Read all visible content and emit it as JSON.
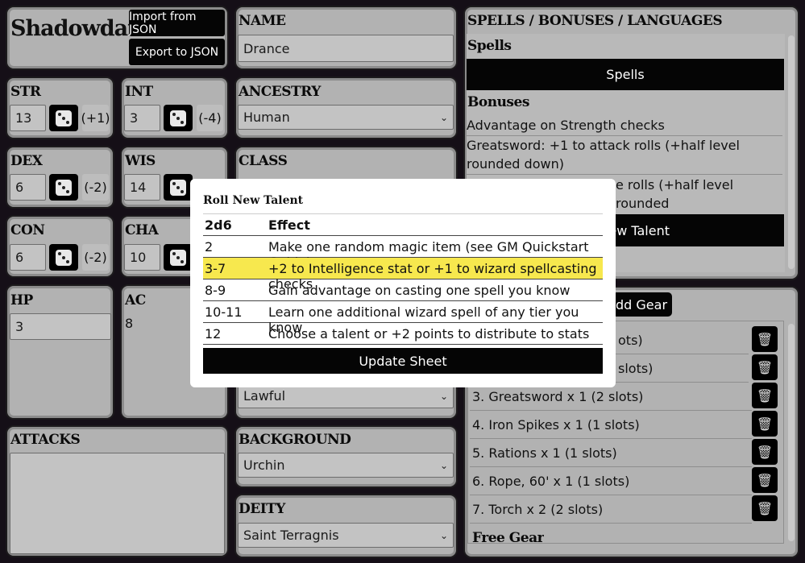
{
  "app": {
    "title": "Shadowdark"
  },
  "toolbar": {
    "import_label": "Import from JSON",
    "export_label": "Export to JSON"
  },
  "stats": [
    {
      "label": "STR",
      "value": "13",
      "mod": "(+1)"
    },
    {
      "label": "INT",
      "value": "3",
      "mod": "(-4)"
    },
    {
      "label": "DEX",
      "value": "6",
      "mod": "(-2)"
    },
    {
      "label": "WIS",
      "value": "14",
      "mod": ""
    },
    {
      "label": "CON",
      "value": "6",
      "mod": "(-2)"
    },
    {
      "label": "CHA",
      "value": "10",
      "mod": ""
    }
  ],
  "hp": {
    "label": "HP",
    "value": "3"
  },
  "ac": {
    "label": "AC",
    "value": "8"
  },
  "attacks": {
    "label": "ATTACKS"
  },
  "name": {
    "label": "NAME",
    "value": "Drance"
  },
  "ancestry": {
    "label": "ANCESTRY",
    "value": "Human"
  },
  "class": {
    "label": "CLASS"
  },
  "alignment": {
    "value": "Lawful"
  },
  "background": {
    "label": "BACKGROUND",
    "value": "Urchin"
  },
  "deity": {
    "label": "DEITY",
    "value": "Saint Terragnis"
  },
  "spells_panel": {
    "label": "SPELLS / BONUSES / LANGUAGES",
    "spells_heading": "Spells",
    "spells_button": "Spells",
    "bonuses_heading": "Bonuses",
    "bonuses": [
      "Advantage on Strength checks",
      "Greatsword: +1 to attack rolls (+half level rounded down)",
      "e rolls (+half level rounded"
    ],
    "new_talent_button": "ew Talent"
  },
  "gear": {
    "add_button": "dd Gear",
    "items": [
      "ots)",
      "slots)",
      "3. Greatsword x 1 (2 slots)",
      "4. Iron Spikes x 1 (1 slots)",
      "5. Rations x 1 (1 slots)",
      "6. Rope, 60' x 1 (1 slots)",
      "7. Torch x 2 (2 slots)"
    ],
    "free_gear_heading": "Free Gear"
  },
  "modal": {
    "title": "Roll New Talent",
    "col_roll": "2d6",
    "col_effect": "Effect",
    "rows": [
      {
        "roll": "2",
        "effect": "Make one random magic item (see GM Quickstart Guide)"
      },
      {
        "roll": "3-7",
        "effect": "+2 to Intelligence stat or +1 to wizard spellcasting checks"
      },
      {
        "roll": "8-9",
        "effect": "Gain advantage on casting one spell you know"
      },
      {
        "roll": "10-11",
        "effect": "Learn one additional wizard spell of any tier you know"
      },
      {
        "roll": "12",
        "effect": "Choose a talent or +2 points to distribute to stats"
      }
    ],
    "update_button": "Update Sheet",
    "highlight_color": "#f7e84e"
  }
}
